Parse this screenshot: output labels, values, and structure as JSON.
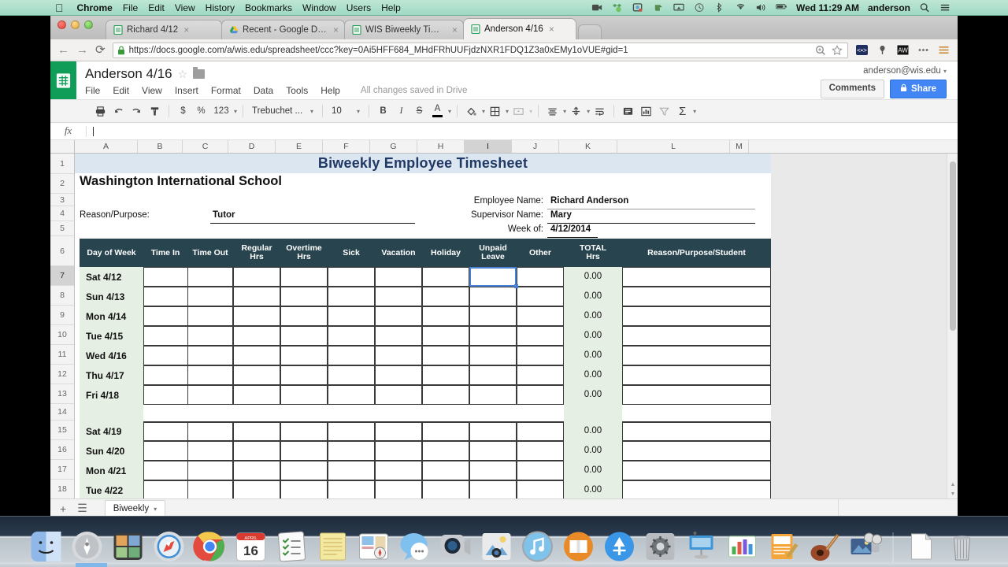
{
  "menubar": {
    "apple": "",
    "items": [
      "Chrome",
      "File",
      "Edit",
      "View",
      "History",
      "Bookmarks",
      "Window",
      "Users",
      "Help"
    ],
    "status_icons": [
      "screen-recorder-icon",
      "dropbox-icon",
      "screenshot-icon",
      "evernote-icon",
      "airplay-icon",
      "timemachine-icon",
      "bluetooth-icon",
      "wifi-icon",
      "volume-icon",
      "battery-icon"
    ],
    "clock": "Wed 11:29 AM",
    "user": "anderson",
    "spotlight": "search-icon",
    "notifications": "notification-center-icon"
  },
  "browser": {
    "tabs": [
      {
        "title": "Richard 4/12",
        "favicon": "sheets-icon",
        "active": false
      },
      {
        "title": "Recent - Google Drive",
        "favicon": "drive-icon",
        "active": false
      },
      {
        "title": "WIS Biweekly Timesheet",
        "favicon": "sheets-icon",
        "active": false
      },
      {
        "title": "Anderson 4/16",
        "favicon": "sheets-icon",
        "active": true
      }
    ],
    "close_label": "×",
    "back": "←",
    "forward": "→",
    "reload": "⟳",
    "url": "https://docs.google.com/a/wis.edu/spreadsheet/ccc?key=0Ai5HFF684_MHdFRhUUFjdzNXR1FDQ1Z3a0xEMy1oVUE#gid=1",
    "url_scheme_label": "https://",
    "omnibox_icons": [
      "zoom-icon",
      "bookmark-star-icon"
    ],
    "extension_icons": [
      "code-extension-icon",
      "lastpass-icon",
      "adblock-icon"
    ],
    "menu_icon": "chrome-menu-icon",
    "more_icon": "more-icon"
  },
  "sheets": {
    "logo": "sheets-logo-icon",
    "doc_title": "Anderson 4/16",
    "star_icon": "star-icon",
    "folder_icon": "folder-icon",
    "menu": [
      "File",
      "Edit",
      "View",
      "Insert",
      "Format",
      "Data",
      "Tools",
      "Help"
    ],
    "save_status": "All changes saved in Drive",
    "account": "anderson@wis.edu",
    "comments_label": "Comments",
    "share_label": "Share",
    "share_icon": "lock-icon",
    "toolbar": {
      "print_icon": "print-icon",
      "undo_icon": "undo-icon",
      "redo_icon": "redo-icon",
      "paint_icon": "paint-format-icon",
      "currency": "$",
      "percent": "%",
      "number_format": "123",
      "font_name": "Trebuchet ...",
      "font_size": "10",
      "bold": "B",
      "italic": "I",
      "strikethrough": "S",
      "text_color": "A",
      "fill_icon": "fill-color-icon",
      "borders_icon": "borders-icon",
      "merge_icon": "merge-cells-icon",
      "align_icon": "horizontal-align-icon",
      "valign_icon": "vertical-align-icon",
      "wrap_icon": "text-wrap-icon",
      "comment_icon": "insert-comment-icon",
      "chart_icon": "insert-chart-icon",
      "filter_icon": "filter-icon",
      "functions_icon": "Σ"
    },
    "namebox": "fx",
    "formula_value": "",
    "columns": [
      "A",
      "B",
      "C",
      "D",
      "E",
      "F",
      "G",
      "H",
      "I",
      "J",
      "K",
      "L",
      "M"
    ],
    "selected_column": "I",
    "selected_row": "7",
    "rows": [
      "1",
      "2",
      "3",
      "4",
      "5",
      "6",
      "7",
      "8",
      "9",
      "10",
      "11",
      "12",
      "13",
      "14",
      "15",
      "16",
      "17",
      "18"
    ],
    "sheet_tabs": {
      "add_icon": "add-sheet-icon",
      "list_icon": "all-sheets-icon",
      "tabs": [
        {
          "name": "Biweekly",
          "active": true
        }
      ],
      "caret": "▾"
    },
    "scrollbar": "vertical-scrollbar"
  },
  "timesheet": {
    "title": "Biweekly Employee Timesheet",
    "organization": "Washington International School",
    "fields": [
      {
        "label": "Reason/Purpose:",
        "value": "Tutor"
      },
      {
        "label": "Employee Name:",
        "value": "Richard Anderson"
      },
      {
        "label": "Supervisor Name:",
        "value": "Mary"
      },
      {
        "label": "Week of:",
        "value": "4/12/2014"
      }
    ],
    "headers": [
      "Day of Week",
      "Time In",
      "Time Out",
      "Regular Hrs",
      "Overtime Hrs",
      "Sick",
      "Vacation",
      "Holiday",
      "Unpaid Leave",
      "Other",
      "TOTAL Hrs",
      "Reason/Purpose/Student"
    ],
    "headers_wrapped": [
      [
        "Day of Week"
      ],
      [
        "Time In"
      ],
      [
        "Time Out"
      ],
      [
        "Regular",
        "Hrs"
      ],
      [
        "Overtime",
        "Hrs"
      ],
      [
        "Sick"
      ],
      [
        "Vacation"
      ],
      [
        "Holiday"
      ],
      [
        "Unpaid",
        "Leave"
      ],
      [
        "Other"
      ],
      [
        "TOTAL",
        "Hrs"
      ],
      [
        "Reason/Purpose/Student"
      ]
    ],
    "week1": [
      {
        "row": "7",
        "day": "Sat 4/12",
        "total": "0.00"
      },
      {
        "row": "8",
        "day": "Sun 4/13",
        "total": "0.00"
      },
      {
        "row": "9",
        "day": "Mon 4/14",
        "total": "0.00"
      },
      {
        "row": "10",
        "day": "Tue 4/15",
        "total": "0.00"
      },
      {
        "row": "11",
        "day": "Wed 4/16",
        "total": "0.00"
      },
      {
        "row": "12",
        "day": "Thu 4/17",
        "total": "0.00"
      },
      {
        "row": "13",
        "day": "Fri 4/18",
        "total": "0.00"
      }
    ],
    "week2": [
      {
        "row": "15",
        "day": "Sat 4/19",
        "total": "0.00"
      },
      {
        "row": "16",
        "day": "Sun 4/20",
        "total": "0.00"
      },
      {
        "row": "17",
        "day": "Mon 4/21",
        "total": "0.00"
      },
      {
        "row": "18",
        "day": "Tue 4/22",
        "total": "0.00"
      }
    ],
    "colors": {
      "title_band": "#dce6f1",
      "title_text": "#1f3864",
      "header_band": "#28454f",
      "green_band": "#e6efe3",
      "selection": "#4a80d4"
    }
  },
  "dock": {
    "items": [
      "finder-icon",
      "launchpad-icon",
      "photobooth-icon",
      "safari-icon",
      "chrome-icon",
      "calendar-icon",
      "reminders-icon",
      "notes-icon",
      "news-icon",
      "messages-icon",
      "facetime-icon",
      "iphoto-icon",
      "itunes-icon",
      "ibooks-icon",
      "appstore-icon",
      "system-preferences-icon",
      "keynote-icon",
      "numbers-icon",
      "pages-icon",
      "garageband-icon",
      "imovie-icon"
    ],
    "right_items": [
      "documents-stack-icon",
      "trash-icon"
    ],
    "calendar_day": "16",
    "calendar_month": "APRIL"
  }
}
